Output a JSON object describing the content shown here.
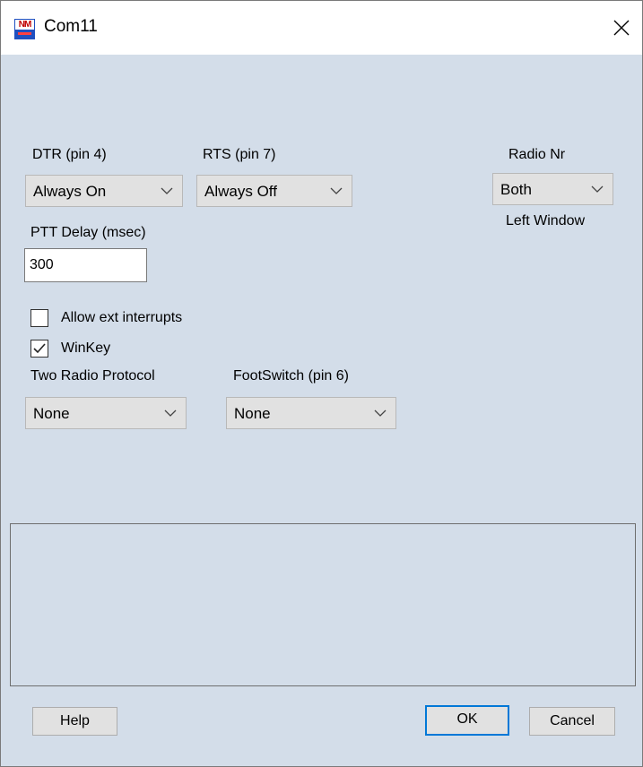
{
  "window": {
    "title": "Com11",
    "app_icon_text": "NM"
  },
  "dtr": {
    "label": "DTR (pin 4)",
    "value": "Always On"
  },
  "rts": {
    "label": "RTS (pin 7)",
    "value": "Always Off"
  },
  "radio_nr": {
    "label": "Radio Nr",
    "value": "Both",
    "sub_label": "Left Window"
  },
  "ptt_delay": {
    "label": "PTT Delay  (msec)",
    "value": "300"
  },
  "checkboxes": [
    {
      "label": "Allow ext interrupts",
      "checked": false
    },
    {
      "label": "WinKey",
      "checked": true
    }
  ],
  "two_radio_protocol": {
    "label": "Two Radio Protocol",
    "value": "None"
  },
  "footswitch": {
    "label": "FootSwitch (pin 6)",
    "value": "None"
  },
  "buttons": {
    "help": "Help",
    "ok": "OK",
    "cancel": "Cancel"
  },
  "colors": {
    "dialog_bg": "#d3dde9",
    "default_button_border": "#0078d7"
  }
}
